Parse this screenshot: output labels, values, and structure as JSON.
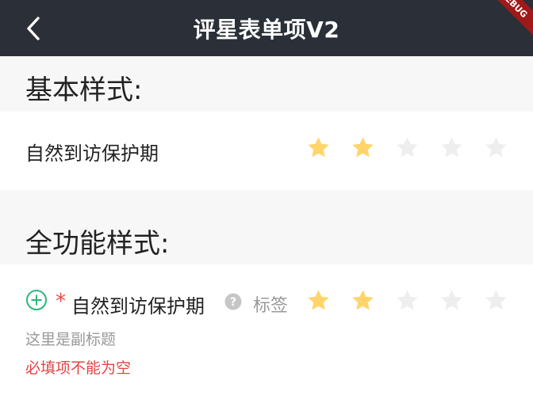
{
  "appbar": {
    "title": "评星表单项V2",
    "back_icon": "chevron-left-icon",
    "debug_banner": "DEBUG"
  },
  "sections": [
    {
      "title": "基本样式:",
      "row": {
        "label": "自然到访保护期",
        "rating": 2,
        "max": 5
      }
    },
    {
      "title": "全功能样式:",
      "row": {
        "add_icon": "plus-circle-icon",
        "required_mark": "*",
        "label": "自然到访保护期",
        "help_icon": "question-circle-icon",
        "tag": "标签",
        "rating": 2,
        "max": 5,
        "subtitle": "这里是副标题",
        "error": "必填项不能为空"
      }
    }
  ],
  "colors": {
    "appbar_bg": "#2b2f37",
    "star_active": "#ffd56b",
    "star_inactive": "#eeeeee",
    "plus_icon": "#2bb77b",
    "required": "#f04848",
    "error": "#e24444"
  }
}
